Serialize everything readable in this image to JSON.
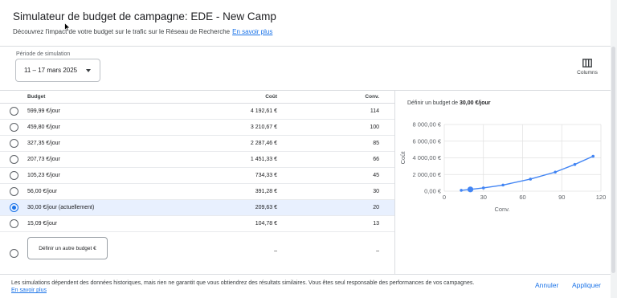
{
  "header": {
    "title": "Simulateur de budget de campagne: EDE - New Camp",
    "subtitle": "Découvrez l'impact de votre budget sur le trafic sur le Réseau de Recherche",
    "learn_more": "En savoir plus"
  },
  "period": {
    "label": "Période de simulation",
    "value": "11 – 17 mars 2025"
  },
  "columns_label": "Columns",
  "table": {
    "headers": {
      "budget": "Budget",
      "cout": "Coût",
      "conv": "Conv."
    },
    "rows": [
      {
        "budget": "599,99 €/jour",
        "cout": "4 192,61 €",
        "conv": "114",
        "selected": false
      },
      {
        "budget": "459,80 €/jour",
        "cout": "3 210,67 €",
        "conv": "100",
        "selected": false
      },
      {
        "budget": "327,35 €/jour",
        "cout": "2 287,46 €",
        "conv": "85",
        "selected": false
      },
      {
        "budget": "207,73 €/jour",
        "cout": "1 451,33 €",
        "conv": "66",
        "selected": false
      },
      {
        "budget": "105,23 €/jour",
        "cout": "734,33 €",
        "conv": "45",
        "selected": false
      },
      {
        "budget": "56,00 €/jour",
        "cout": "391,28 €",
        "conv": "30",
        "selected": false
      },
      {
        "budget": "30,00 €/jour (actuellement)",
        "cout": "209,63 €",
        "conv": "20",
        "selected": true
      },
      {
        "budget": "15,09 €/jour",
        "cout": "104,78 €",
        "conv": "13",
        "selected": false
      }
    ],
    "custom": {
      "label": "Définir un autre budget €",
      "cout": "–",
      "conv": "–"
    }
  },
  "chart_title": {
    "prefix": "Définir un budget de",
    "value": "30,00 €/jour"
  },
  "chart_data": {
    "type": "line",
    "xlabel": "Conv.",
    "ylabel": "Coût",
    "xlim": [
      0,
      120
    ],
    "ylim": [
      0,
      8000
    ],
    "xticks": [
      "0",
      "30",
      "60",
      "90",
      "120"
    ],
    "yticks": [
      "0,00 €",
      "2 000,00 €",
      "4 000,00 €",
      "6 000,00 €",
      "8 000,00 €"
    ],
    "grid": true,
    "color": "#4285f4",
    "series": [
      {
        "x": [
          13,
          20,
          30,
          45,
          66,
          85,
          100,
          114
        ],
        "y": [
          104.78,
          209.63,
          391.28,
          734.33,
          1451.33,
          2287.46,
          3210.67,
          4192.61
        ]
      }
    ],
    "highlight": {
      "x": 20,
      "y": 209.63
    }
  },
  "footer": {
    "note": "Les simulations dépendent des données historiques, mais rien ne garantit que vous obtiendrez des résultats similaires. Vous êtes seul responsable des performances de vos campagnes.",
    "learn_more": "En savoir plus",
    "cancel": "Annuler",
    "apply": "Appliquer"
  }
}
